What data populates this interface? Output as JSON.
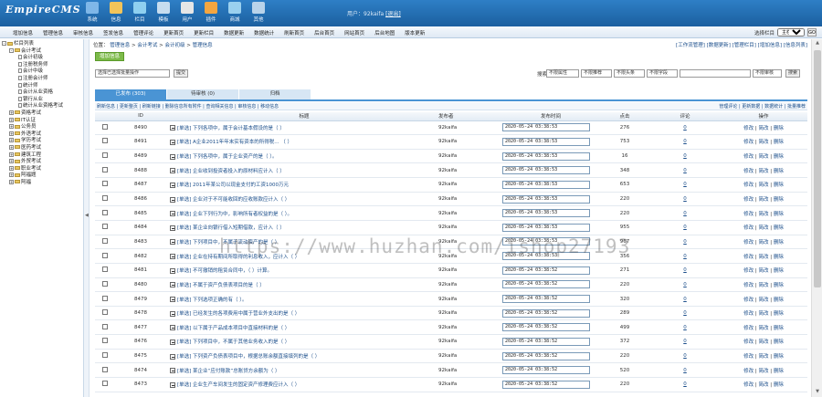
{
  "header": {
    "logo": "EmpireCMS",
    "nav": [
      {
        "label": "系统",
        "icon": "system-icon",
        "color": "#7fb7e8"
      },
      {
        "label": "信息",
        "icon": "info-icon",
        "color": "#f2c45a"
      },
      {
        "label": "栏目",
        "icon": "column-icon",
        "color": "#8fd0f0"
      },
      {
        "label": "模板",
        "icon": "template-icon",
        "color": "#c7ddef"
      },
      {
        "label": "用户",
        "icon": "user-icon",
        "color": "#e6e6e6"
      },
      {
        "label": "插件",
        "icon": "plugin-icon",
        "color": "#f4a640"
      },
      {
        "label": "商城",
        "icon": "shop-icon",
        "color": "#9ad0ef"
      },
      {
        "label": "其他",
        "icon": "other-icon",
        "color": "#b9d3ea"
      }
    ],
    "user_label": "用户：92kaifa",
    "logout_label": "[退出]"
  },
  "subnav": {
    "links": [
      "增加信息",
      "管理信息",
      "审核信息",
      "签发信息",
      "管理评论",
      "更新首页",
      "更新栏目",
      "数据更新",
      "数据统计",
      "刷新首页",
      "后台首页",
      "网站首页",
      "后台地图",
      "版本更新"
    ],
    "right_label": "选择栏目",
    "select_value": "主栏目",
    "go_label": "GO"
  },
  "tree": [
    {
      "label": "栏目列表",
      "level": 0,
      "kind": "folder",
      "expand": "-"
    },
    {
      "label": "会计考试",
      "level": 1,
      "kind": "folder",
      "expand": "-"
    },
    {
      "label": "会计初级",
      "level": 2,
      "kind": "doc"
    },
    {
      "label": "注册税务师",
      "level": 2,
      "kind": "doc"
    },
    {
      "label": "会计中级",
      "level": 2,
      "kind": "doc"
    },
    {
      "label": "注册会计师",
      "level": 2,
      "kind": "doc"
    },
    {
      "label": "统计师",
      "level": 2,
      "kind": "doc"
    },
    {
      "label": "会计从业资格",
      "level": 2,
      "kind": "doc"
    },
    {
      "label": "银行从业",
      "level": 2,
      "kind": "doc"
    },
    {
      "label": "统计从业资格考试",
      "level": 2,
      "kind": "doc"
    },
    {
      "label": "资格考试",
      "level": 1,
      "kind": "folder",
      "expand": "+"
    },
    {
      "label": "IT认证",
      "level": 1,
      "kind": "folder",
      "expand": "+"
    },
    {
      "label": "公务员",
      "level": 1,
      "kind": "folder",
      "expand": "+"
    },
    {
      "label": "外语考试",
      "level": 1,
      "kind": "folder",
      "expand": "+"
    },
    {
      "label": "学历考试",
      "level": 1,
      "kind": "folder",
      "expand": "+"
    },
    {
      "label": "医药考试",
      "level": 1,
      "kind": "folder",
      "expand": "+"
    },
    {
      "label": "建筑工程",
      "level": 1,
      "kind": "folder",
      "expand": "+"
    },
    {
      "label": "外贸考试",
      "level": 1,
      "kind": "folder",
      "expand": "+"
    },
    {
      "label": "职业考试",
      "level": 1,
      "kind": "folder",
      "expand": "+"
    },
    {
      "label": "阿福题",
      "level": 1,
      "kind": "folder",
      "expand": "+"
    },
    {
      "label": "阿福",
      "level": 1,
      "kind": "folder",
      "expand": "+"
    }
  ],
  "main": {
    "crumb_prefix": "位置：",
    "crumb": [
      "管理信息",
      "会计考试",
      "会计初级",
      "管理信息"
    ],
    "crumb_right": "[工作流管理] [数据更新] [管理栏目] [增加信息] [信息列表]",
    "add_button": "增加信息",
    "toolbar": {
      "batch_select": "选择已选择批量操作",
      "submit": "提交",
      "search_label": "搜索:",
      "filters": [
        "不限属性",
        "不限推荐",
        "不限头条",
        "不限字段",
        "不限审核",
        "全部时间"
      ],
      "search_button": "搜索"
    },
    "tabs": [
      "已发布 (303)",
      "待审核 (0)",
      "归档"
    ],
    "action_left": "刷新信息 | 更新整页 | 刷新链接 | 删除信息所有附件 | 查询相关信息 | 审核信息 | 移动信息",
    "action_right": "管理评论 | 更新数据 | 数据统计 | 批量推荐"
  },
  "table": {
    "headers": [
      "",
      "ID",
      "标题",
      "发布者",
      "发布时间",
      "点击",
      "评论",
      "操作"
    ],
    "rows": [
      {
        "id": "8490",
        "title": "[单选] 下列各项中，属于会计基本假设的是（ ）",
        "pub": "92kaifa",
        "time": "2020-05-24 03:38:53",
        "hits": "276",
        "cmt": "0"
      },
      {
        "id": "8491",
        "title": "[单选] A企业2011年年末实有资本的所得税... （ ）",
        "pub": "92kaifa",
        "time": "2020-05-24 03:38:53",
        "hits": "753",
        "cmt": "0"
      },
      {
        "id": "8489",
        "title": "[单选] 下列各项中，属于企业资产的是（ ）。",
        "pub": "92kaifa",
        "time": "2020-05-24 03:38:53",
        "hits": "16",
        "cmt": "0"
      },
      {
        "id": "8488",
        "title": "[单选] 企业收到投资者投入的原材料应计入（ ）",
        "pub": "92kaifa",
        "time": "2020-05-24 03:38:53",
        "hits": "348",
        "cmt": "0"
      },
      {
        "id": "8487",
        "title": "[单选] 2011年某公司以现金支付的工资1000万元",
        "pub": "92kaifa",
        "time": "2020-05-24 03:38:53",
        "hits": "653",
        "cmt": "0"
      },
      {
        "id": "8486",
        "title": "[单选] 企业对于不可能收回的应收账款应计入（ ）",
        "pub": "92kaifa",
        "time": "2020-05-24 03:38:53",
        "hits": "220",
        "cmt": "0"
      },
      {
        "id": "8485",
        "title": "[单选] 企业下列行为中，影响所有者权益的是（ ）。",
        "pub": "92kaifa",
        "time": "2020-05-24 03:38:53",
        "hits": "220",
        "cmt": "0"
      },
      {
        "id": "8484",
        "title": "[单选] 某企业向银行借入短期借款，应计入（ ）",
        "pub": "92kaifa",
        "time": "2020-05-24 03:38:53",
        "hits": "955",
        "cmt": "0"
      },
      {
        "id": "8483",
        "title": "[单选] 下列项目中，不属于流动资产的是（ ）",
        "pub": "92kaifa",
        "time": "2020-05-24 03:38:53",
        "hits": "967",
        "cmt": "0"
      },
      {
        "id": "8482",
        "title": "[单选] 企业在持有期间所取得的利息收入，应计入（ ）",
        "pub": "92kaifa",
        "time": "2020-05-24 03:38:53",
        "hits": "356",
        "cmt": "0"
      },
      {
        "id": "8481",
        "title": "[单选] 不可撤销的租赁合同中，（ ）计算。",
        "pub": "92kaifa",
        "time": "2020-05-24 03:38:52",
        "hits": "271",
        "cmt": "0"
      },
      {
        "id": "8480",
        "title": "[单选] 不属于资产负债表项目的是（ ）",
        "pub": "92kaifa",
        "time": "2020-05-24 03:38:52",
        "hits": "220",
        "cmt": "0"
      },
      {
        "id": "8479",
        "title": "[单选] 下列选项正确的有（ ）。",
        "pub": "92kaifa",
        "time": "2020-05-24 03:38:52",
        "hits": "320",
        "cmt": "0"
      },
      {
        "id": "8478",
        "title": "[单选] 已经发生的各项费用中属于营业外支出的是（ ）",
        "pub": "92kaifa",
        "time": "2020-05-24 03:38:52",
        "hits": "289",
        "cmt": "0"
      },
      {
        "id": "8477",
        "title": "[单选] 以下属于产品成本项目中直接材料的是（ ）",
        "pub": "92kaifa",
        "time": "2020-05-24 03:38:52",
        "hits": "499",
        "cmt": "0"
      },
      {
        "id": "8476",
        "title": "[单选] 下列项目中，不属于其他业务收入的是（ ）",
        "pub": "92kaifa",
        "time": "2020-05-24 03:38:52",
        "hits": "372",
        "cmt": "0"
      },
      {
        "id": "8475",
        "title": "[单选] 下列资产负债表项目中，根据总账余额直接填列的是（ ）",
        "pub": "92kaifa",
        "time": "2020-05-24 03:38:52",
        "hits": "220",
        "cmt": "0"
      },
      {
        "id": "8474",
        "title": "[单选] 某企业“应付账款”总账贷方余额为（ ）",
        "pub": "92kaifa",
        "time": "2020-05-24 03:38:52",
        "hits": "520",
        "cmt": "0"
      },
      {
        "id": "8473",
        "title": "[单选] 企业生产车间发生的固定资产修理费应计入（ ）",
        "pub": "92kaifa",
        "time": "2020-05-24 03:38:52",
        "hits": "220",
        "cmt": "0"
      }
    ],
    "op_labels": [
      "修改",
      "简改",
      "删除"
    ]
  },
  "watermark": "https://www.huzhan.com/ishop27193",
  "colors": {
    "header": "#1b5f9f",
    "tab_active": "#4a94d4",
    "add_button": "#7dba4a",
    "link": "#1a4d8a"
  }
}
